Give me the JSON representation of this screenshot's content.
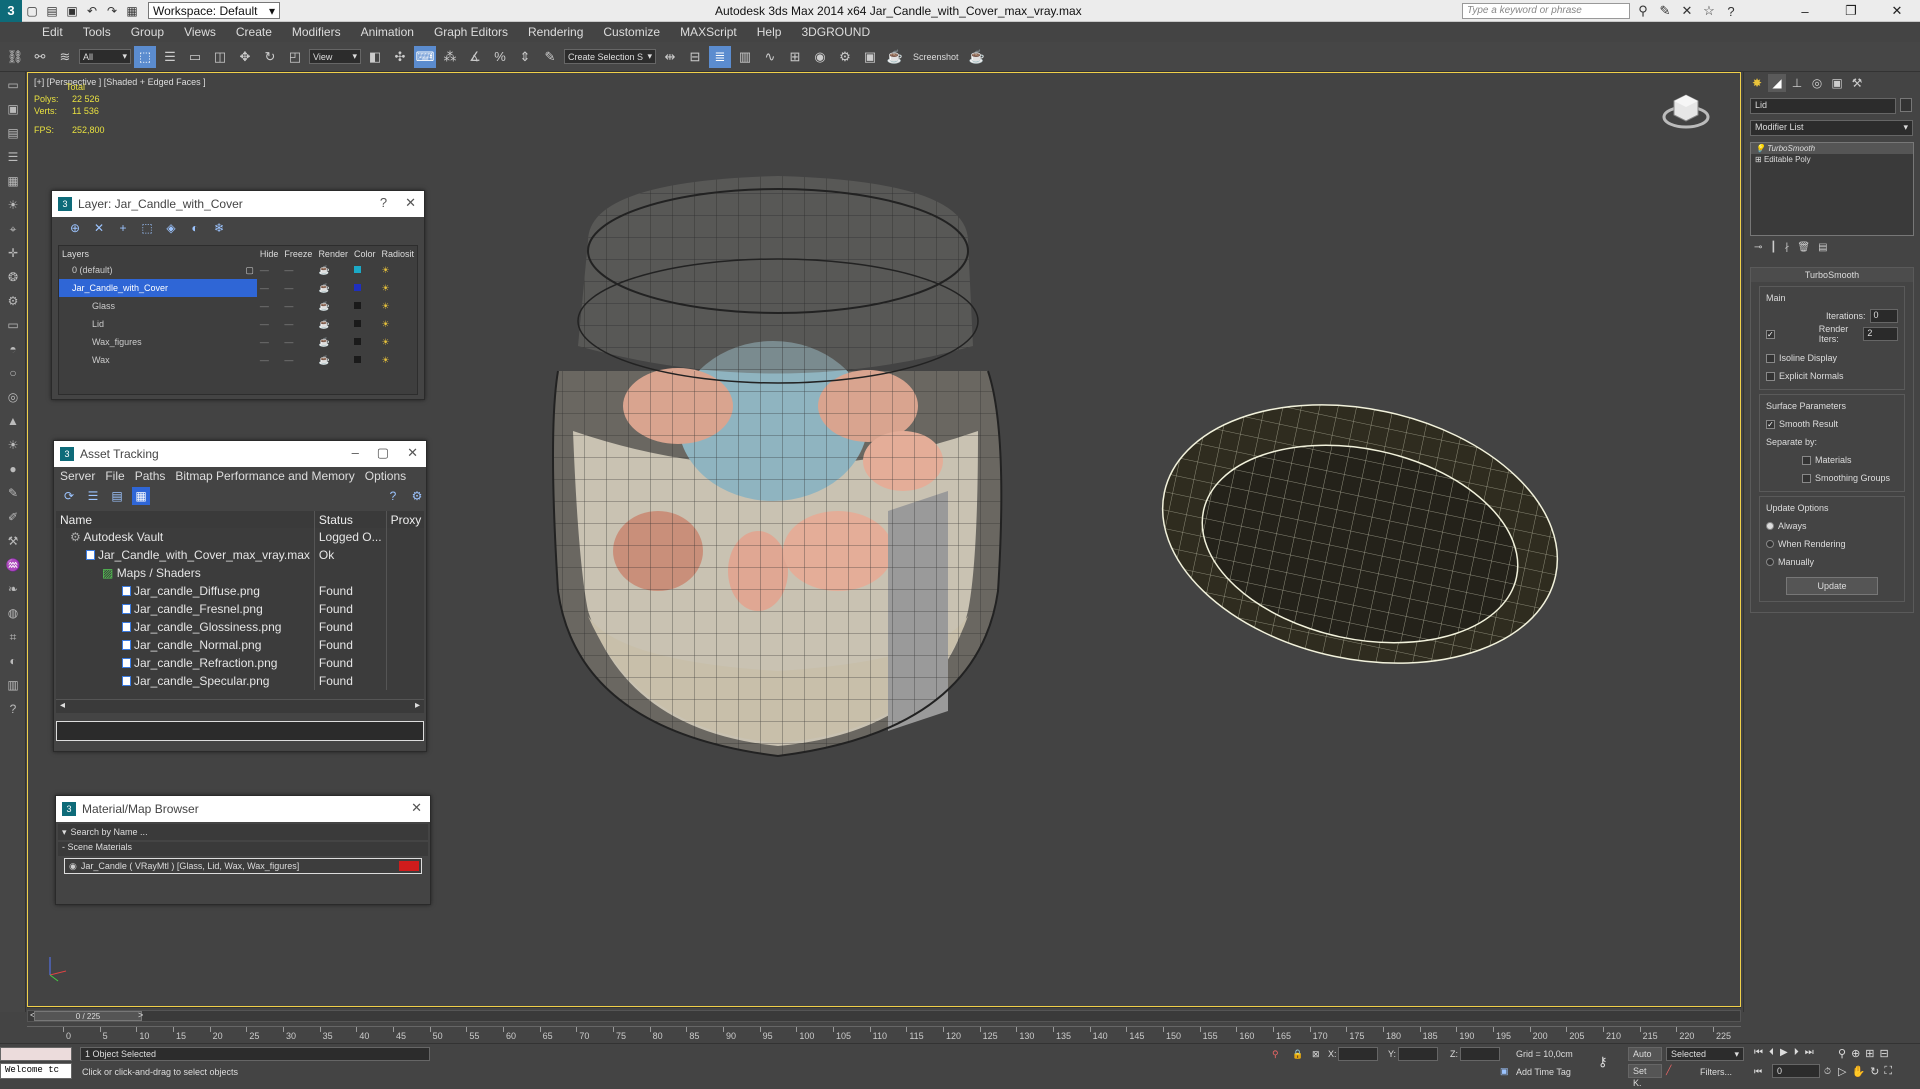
{
  "titlebar": {
    "app_title": "Autodesk 3ds Max  2014 x64     Jar_Candle_with_Cover_max_vray.max",
    "workspace": "Workspace: Default",
    "search_placeholder": "Type a keyword or phrase"
  },
  "menu": [
    "Edit",
    "Tools",
    "Group",
    "Views",
    "Create",
    "Modifiers",
    "Animation",
    "Graph Editors",
    "Rendering",
    "Customize",
    "MAXScript",
    "Help",
    "3DGROUND"
  ],
  "toolbar": {
    "filter": "All",
    "refcoord": "View",
    "selset": "Create Selection S",
    "screenshot_label": "Screenshot"
  },
  "viewport": {
    "label": "[+] [Perspective ] [Shaded + Edged Faces ]",
    "stats": {
      "total": "Total",
      "polys_label": "Polys:",
      "polys": "22 526",
      "verts_label": "Verts:",
      "verts": "11 536",
      "fps_label": "FPS:",
      "fps": "252,800"
    }
  },
  "layer_panel": {
    "title": "Layer: Jar_Candle_with_Cover",
    "headers": [
      "Layers",
      "Hide",
      "Freeze",
      "Render",
      "Color",
      "Radiosit"
    ],
    "rows": [
      {
        "name": "0 (default)",
        "color": "#1ba9c6"
      },
      {
        "name": "Jar_Candle_with_Cover",
        "color": "#1f2fbf"
      },
      {
        "name": "Glass",
        "color": "#1a1a1a"
      },
      {
        "name": "Lid",
        "color": "#1a1a1a"
      },
      {
        "name": "Wax_figures",
        "color": "#1a1a1a"
      },
      {
        "name": "Wax",
        "color": "#1a1a1a"
      }
    ]
  },
  "asset_panel": {
    "title": "Asset Tracking",
    "menu": [
      "Server",
      "File",
      "Paths",
      "Bitmap Performance and Memory",
      "Options"
    ],
    "headers": [
      "Name",
      "Status",
      "Proxy"
    ],
    "rows": [
      {
        "name": "Autodesk Vault",
        "status": "Logged O..."
      },
      {
        "name": "Jar_Candle_with_Cover_max_vray.max",
        "status": "Ok"
      },
      {
        "name": "Maps / Shaders",
        "status": ""
      },
      {
        "name": "Jar_candle_Diffuse.png",
        "status": "Found"
      },
      {
        "name": "Jar_candle_Fresnel.png",
        "status": "Found"
      },
      {
        "name": "Jar_candle_Glossiness.png",
        "status": "Found"
      },
      {
        "name": "Jar_candle_Normal.png",
        "status": "Found"
      },
      {
        "name": "Jar_candle_Refraction.png",
        "status": "Found"
      },
      {
        "name": "Jar_candle_Specular.png",
        "status": "Found"
      }
    ]
  },
  "material_panel": {
    "title": "Material/Map Browser",
    "search_placeholder": "Search by Name ...",
    "section": "- Scene Materials",
    "item": "Jar_Candle  ( VRayMtl )  [Glass, Lid, Wax, Wax_figures]"
  },
  "command_panel": {
    "object_name": "Lid",
    "modifier_list": "Modifier List",
    "stack": [
      "TurboSmooth",
      "Editable Poly"
    ],
    "rollout_title": "TurboSmooth",
    "main_label": "Main",
    "iterations_label": "Iterations:",
    "iterations": "0",
    "render_iters_label": "Render Iters:",
    "render_iters": "2",
    "isoline": "Isoline Display",
    "explicit": "Explicit Normals",
    "surface_label": "Surface Parameters",
    "smooth_result": "Smooth Result",
    "separate_by": "Separate by:",
    "materials": "Materials",
    "smoothing_groups": "Smoothing Groups",
    "update_options": "Update Options",
    "always": "Always",
    "when_rendering": "When Rendering",
    "manually": "Manually",
    "update_button": "Update"
  },
  "timeline": {
    "frame": "0 / 225",
    "ticks": [
      "0",
      "5",
      "10",
      "15",
      "20",
      "25",
      "30",
      "35",
      "40",
      "45",
      "50",
      "55",
      "60",
      "65",
      "70",
      "75",
      "80",
      "85",
      "90",
      "95",
      "100",
      "105",
      "110",
      "115",
      "120",
      "125",
      "130",
      "135",
      "140",
      "145",
      "150",
      "155",
      "160",
      "165",
      "170",
      "175",
      "180",
      "185",
      "190",
      "195",
      "200",
      "205",
      "210",
      "215",
      "220",
      "225"
    ]
  },
  "status": {
    "welcome": "Welcome tc",
    "selected": "1 Object Selected",
    "hint": "Click or click-and-drag to select objects",
    "x_label": "X:",
    "y_label": "Y:",
    "z_label": "Z:",
    "grid": "Grid = 10,0cm",
    "add_time_tag": "Add Time Tag",
    "auto": "Auto",
    "selected_dd": "Selected",
    "setk": "Set K.",
    "filters": "Filters...",
    "frame_field": "0"
  }
}
